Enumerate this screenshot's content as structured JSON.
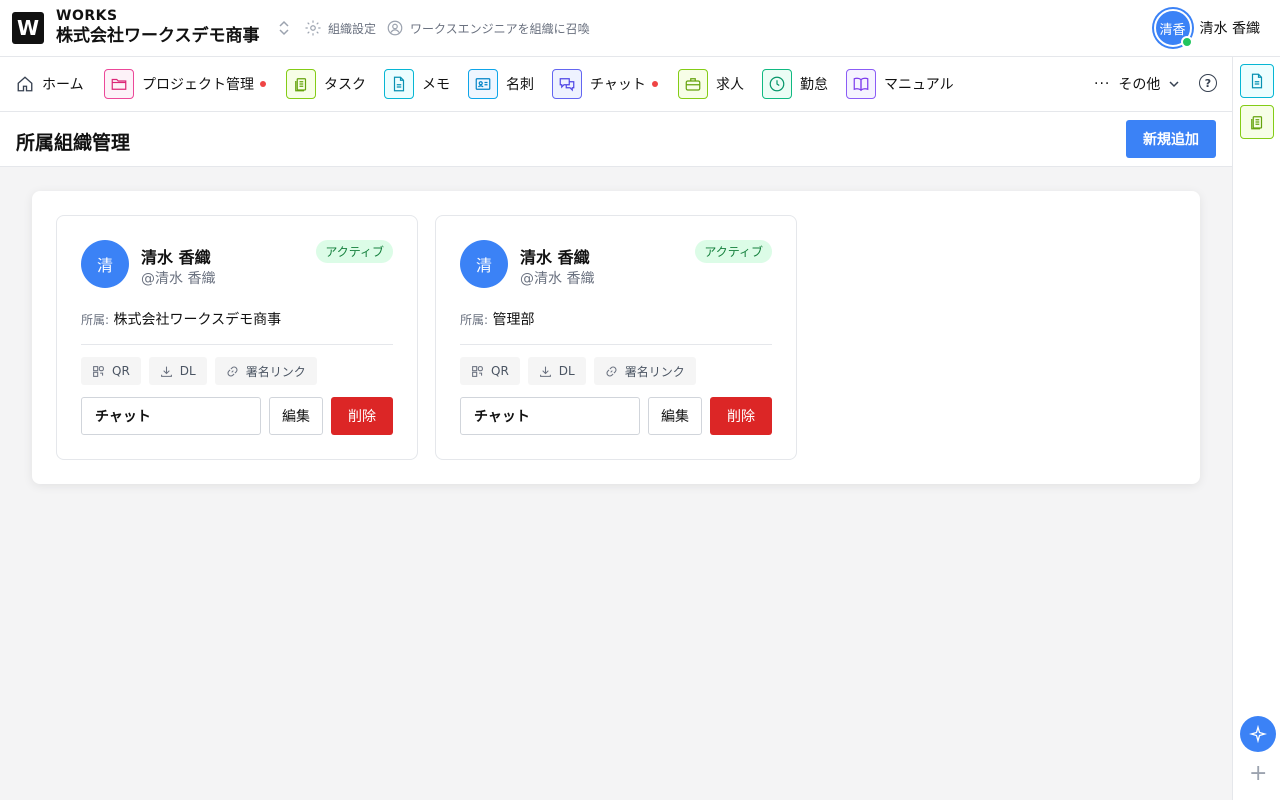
{
  "header": {
    "logo_letter": "W",
    "brand_top": "WORKS",
    "org_name": "株式会社ワークスデモ商事",
    "org_settings": "組織設定",
    "invite_engineer": "ワークスエンジニアを組織に召喚",
    "user_avatar_text": "清香",
    "user_name": "清水 香織"
  },
  "nav": {
    "items": [
      {
        "label": "ホーム"
      },
      {
        "label": "プロジェクト管理"
      },
      {
        "label": "タスク"
      },
      {
        "label": "メモ"
      },
      {
        "label": "名刺"
      },
      {
        "label": "チャット"
      },
      {
        "label": "求人"
      },
      {
        "label": "勤怠"
      },
      {
        "label": "マニュアル"
      }
    ],
    "more_label": "その他",
    "help_glyph": "?"
  },
  "page": {
    "title": "所属組織管理",
    "add_button": "新規追加"
  },
  "cards": [
    {
      "avatar": "清",
      "name": "清水 香織",
      "handle": "@清水 香織",
      "status": "アクティブ",
      "affiliation_label": "所属:",
      "affiliation": "株式会社ワークスデモ商事",
      "qr": "QR",
      "dl": "DL",
      "sign_link": "署名リンク",
      "chat": "チャット",
      "edit": "編集",
      "delete": "削除"
    },
    {
      "avatar": "清",
      "name": "清水 香織",
      "handle": "@清水 香織",
      "status": "アクティブ",
      "affiliation_label": "所属:",
      "affiliation": "管理部",
      "qr": "QR",
      "dl": "DL",
      "sign_link": "署名リンク",
      "chat": "チャット",
      "edit": "編集",
      "delete": "削除"
    }
  ],
  "colors": {
    "primary": "#3b82f6",
    "danger": "#dc2626",
    "active_bg": "#dcfce7",
    "active_text": "#15803d"
  }
}
